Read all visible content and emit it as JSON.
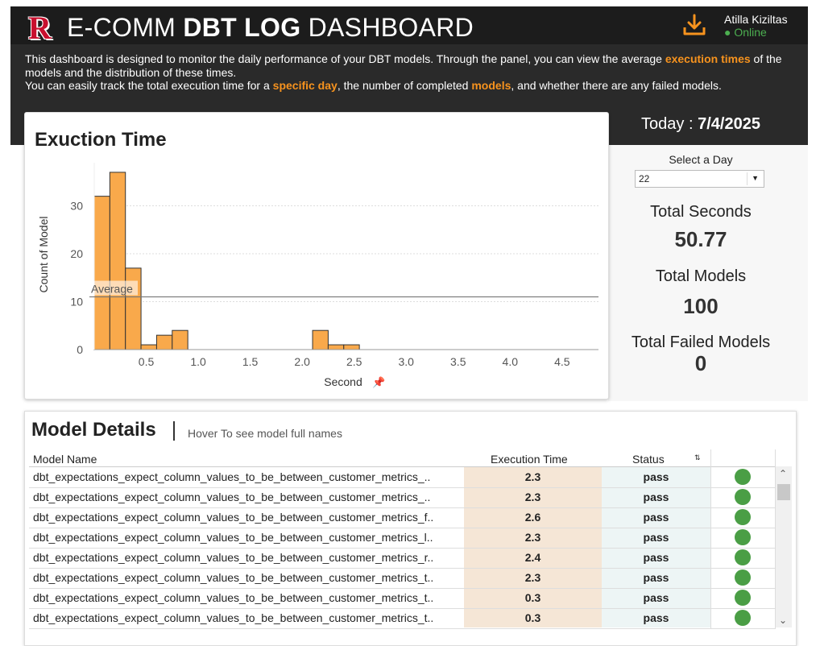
{
  "header": {
    "logo": "R",
    "title_prefix": "E-COMM",
    "title_bold": "DBT LOG",
    "title_suffix": "DASHBOARD",
    "download_icon": "download-icon",
    "user_name": "Atilla Kiziltas",
    "user_status": "● Online"
  },
  "description": {
    "l1a": "This dashboard is designed to monitor the daily performance of your DBT models. Through the panel, you can view the average",
    "l1b": "execution times",
    "l1c": "of the models and the distribution of these times.",
    "l2a": "You can easily track the total execution time for a",
    "l2b": "specific day",
    "l2c": ", the number of completed",
    "l2d": "models",
    "l2e": ", and whether there are any failed models."
  },
  "colors": {
    "accent": "#f7931e",
    "bar": "#f9a94b",
    "online": "#4caf50",
    "pass_dot": "#4a9e45"
  },
  "chart_data": {
    "type": "bar",
    "title": "Exuction Time",
    "xlabel": "Second",
    "ylabel": "Count of Model",
    "bin_width": 0.15,
    "bins": [
      {
        "x0": 0.0,
        "count": 32
      },
      {
        "x0": 0.15,
        "count": 37
      },
      {
        "x0": 0.3,
        "count": 17
      },
      {
        "x0": 0.45,
        "count": 1
      },
      {
        "x0": 0.6,
        "count": 3
      },
      {
        "x0": 0.75,
        "count": 4
      },
      {
        "x0": 2.1,
        "count": 4
      },
      {
        "x0": 2.25,
        "count": 1
      },
      {
        "x0": 2.4,
        "count": 1
      }
    ],
    "xticks": [
      "0.5",
      "1.0",
      "1.5",
      "2.0",
      "2.5",
      "3.0",
      "3.5",
      "4.0",
      "4.5"
    ],
    "yticks": [
      "0",
      "10",
      "20",
      "30"
    ],
    "xlim": [
      0.0,
      4.85
    ],
    "ylim": [
      0,
      39
    ],
    "average_label": "Average",
    "average_value": 11,
    "pin_icon": "pin-icon"
  },
  "sidebar": {
    "today_label": "Today :",
    "today_value": "7/4/2025",
    "select_label": "Select a Day",
    "select_value": "22",
    "total_seconds_label": "Total Seconds",
    "total_seconds_value": "50.77",
    "total_models_label": "Total Models",
    "total_models_value": "100",
    "total_failed_label": "Total Failed Models",
    "total_failed_value": "0"
  },
  "details": {
    "title": "Model Details",
    "hint": "Hover To see model full names",
    "columns": [
      "Model Name",
      "Execution Time",
      "Status"
    ],
    "sort_icon": "sort-icon",
    "rows": [
      {
        "name": "dbt_expectations_expect_column_values_to_be_between_customer_metrics_..",
        "time": "2.3",
        "status": "pass"
      },
      {
        "name": "dbt_expectations_expect_column_values_to_be_between_customer_metrics_..",
        "time": "2.3",
        "status": "pass"
      },
      {
        "name": "dbt_expectations_expect_column_values_to_be_between_customer_metrics_f..",
        "time": "2.6",
        "status": "pass"
      },
      {
        "name": "dbt_expectations_expect_column_values_to_be_between_customer_metrics_l..",
        "time": "2.3",
        "status": "pass"
      },
      {
        "name": "dbt_expectations_expect_column_values_to_be_between_customer_metrics_r..",
        "time": "2.4",
        "status": "pass"
      },
      {
        "name": "dbt_expectations_expect_column_values_to_be_between_customer_metrics_t..",
        "time": "2.3",
        "status": "pass"
      },
      {
        "name": "dbt_expectations_expect_column_values_to_be_between_customer_metrics_t..",
        "time": "0.3",
        "status": "pass"
      },
      {
        "name": "dbt_expectations_expect_column_values_to_be_between_customer_metrics_t..",
        "time": "0.3",
        "status": "pass"
      }
    ]
  }
}
